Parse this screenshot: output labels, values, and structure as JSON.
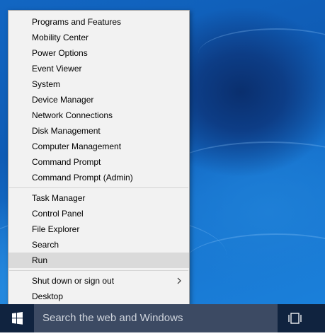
{
  "menu": {
    "items": [
      {
        "label": "Programs and Features"
      },
      {
        "label": "Mobility Center"
      },
      {
        "label": "Power Options"
      },
      {
        "label": "Event Viewer"
      },
      {
        "label": "System"
      },
      {
        "label": "Device Manager"
      },
      {
        "label": "Network Connections"
      },
      {
        "label": "Disk Management"
      },
      {
        "label": "Computer Management"
      },
      {
        "label": "Command Prompt"
      },
      {
        "label": "Command Prompt (Admin)"
      },
      {
        "label": "Task Manager"
      },
      {
        "label": "Control Panel"
      },
      {
        "label": "File Explorer"
      },
      {
        "label": "Search"
      },
      {
        "label": "Run",
        "highlighted": true
      },
      {
        "label": "Shut down or sign out",
        "submenu": true
      },
      {
        "label": "Desktop"
      }
    ]
  },
  "taskbar": {
    "search_placeholder": "Search the web and Windows",
    "start_icon": "windows-logo-icon",
    "task_view_icon": "task-view-icon"
  },
  "colors": {
    "menu_background": "#f2f2f2",
    "menu_highlight": "#dadada",
    "taskbar_background": "#10233f",
    "search_background": "#3c4a63",
    "desktop_accent": "#1266c2"
  }
}
